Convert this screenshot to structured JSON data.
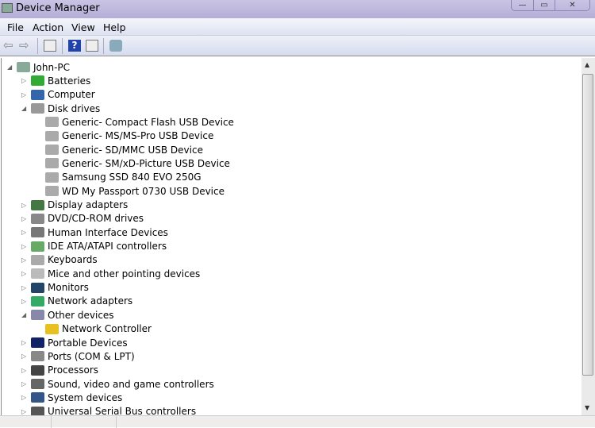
{
  "window": {
    "title": "Device Manager",
    "minimize": "—",
    "maximize": "▭",
    "close": "✕"
  },
  "menu": [
    "File",
    "Action",
    "View",
    "Help"
  ],
  "toolbar": {
    "icons": [
      "back-arrow-icon",
      "forward-arrow-icon",
      "show-hide-console-tree-icon",
      "help-icon",
      "properties-icon",
      "scan-hardware-icon"
    ]
  },
  "tree": {
    "root": "John-PC",
    "items": [
      {
        "label": "Batteries",
        "icon": "battery-icon",
        "color": "#3a3"
      },
      {
        "label": "Computer",
        "icon": "computer-icon",
        "color": "#36a"
      },
      {
        "label": "Disk drives",
        "icon": "disk-drive-icon",
        "color": "#999",
        "expanded": true,
        "children": [
          {
            "label": "Generic- Compact Flash USB Device"
          },
          {
            "label": "Generic- MS/MS-Pro USB Device"
          },
          {
            "label": "Generic- SD/MMC USB Device"
          },
          {
            "label": "Generic- SM/xD-Picture USB Device"
          },
          {
            "label": "Samsung SSD 840 EVO 250G"
          },
          {
            "label": "WD My Passport 0730 USB Device"
          }
        ]
      },
      {
        "label": "Display adapters",
        "icon": "display-adapter-icon",
        "color": "#474"
      },
      {
        "label": "DVD/CD-ROM drives",
        "icon": "dvd-drive-icon",
        "color": "#888"
      },
      {
        "label": "Human Interface Devices",
        "icon": "hid-icon",
        "color": "#777"
      },
      {
        "label": "IDE ATA/ATAPI controllers",
        "icon": "ide-controller-icon",
        "color": "#6a6"
      },
      {
        "label": "Keyboards",
        "icon": "keyboard-icon",
        "color": "#aaa"
      },
      {
        "label": "Mice and other pointing devices",
        "icon": "mouse-icon",
        "color": "#bbb"
      },
      {
        "label": "Monitors",
        "icon": "monitor-icon",
        "color": "#246"
      },
      {
        "label": "Network adapters",
        "icon": "network-adapter-icon",
        "color": "#3a6"
      },
      {
        "label": "Other devices",
        "icon": "unknown-device-icon",
        "color": "#88a",
        "expanded": true,
        "children": [
          {
            "label": "Network Controller",
            "icon": "warning-icon",
            "color": "#e8c020"
          }
        ]
      },
      {
        "label": "Portable Devices",
        "icon": "portable-device-icon",
        "color": "#126"
      },
      {
        "label": "Ports (COM & LPT)",
        "icon": "port-icon",
        "color": "#888"
      },
      {
        "label": "Processors",
        "icon": "processor-icon",
        "color": "#444"
      },
      {
        "label": "Sound, video and game controllers",
        "icon": "speaker-icon",
        "color": "#666"
      },
      {
        "label": "System devices",
        "icon": "system-device-icon",
        "color": "#358"
      },
      {
        "label": "Universal Serial Bus controllers",
        "icon": "usb-icon",
        "color": "#555"
      }
    ]
  }
}
